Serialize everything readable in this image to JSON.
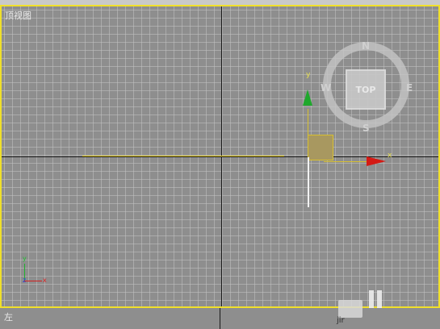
{
  "viewport": {
    "label": "顶视图",
    "gizmo": {
      "x_label": "x",
      "y_label": "y"
    },
    "view_cube": {
      "face_label": "TOP",
      "compass": {
        "north": "N",
        "south": "S",
        "east": "E",
        "west": "W"
      }
    },
    "world_axes": {
      "x_label": "x",
      "y_label": "y",
      "z_label": "z"
    }
  },
  "bottom_viewport": {
    "label": "左"
  },
  "watermark": {
    "text": "jir"
  },
  "colors": {
    "active_border": "#f0e02a",
    "x_axis": "#d41a14",
    "y_axis": "#1fa82c",
    "grid_background": "#8e8e8e"
  }
}
